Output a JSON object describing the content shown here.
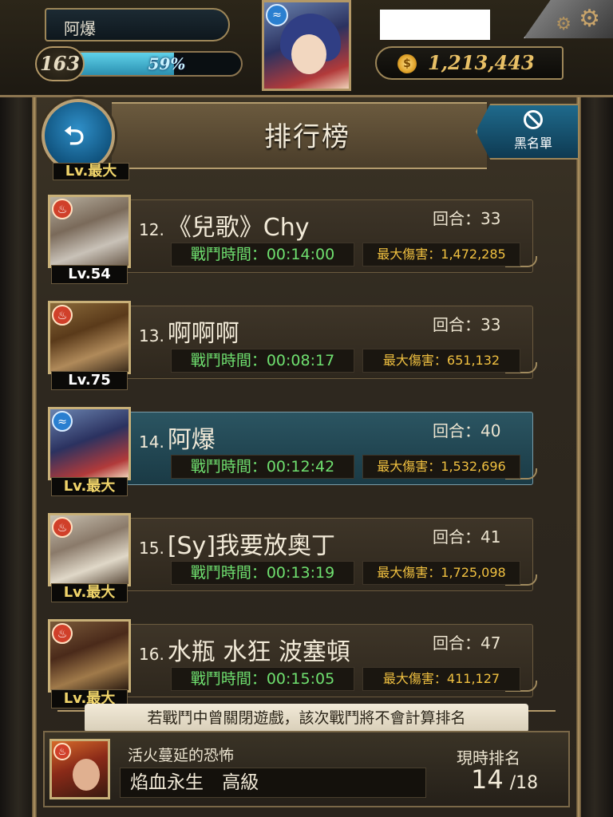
{
  "player": {
    "name": "阿爆",
    "level": "163",
    "exp_percent_text": "59%",
    "exp_fraction": 0.59,
    "coins": "1,213,443"
  },
  "header": {
    "title": "排行榜",
    "blacklist_label": "黑名單",
    "partial_level": "Lv.最大"
  },
  "rankings": [
    {
      "rank": "12.",
      "name": "《兒歌》Chy",
      "level": "Lv.54",
      "rounds": "回合：33",
      "time": "戰鬥時間：00:14:00",
      "damage": "最大傷害：1,472,285",
      "element": "fire"
    },
    {
      "rank": "13.",
      "name": "啊啊啊",
      "level": "Lv.75",
      "rounds": "回合：33",
      "time": "戰鬥時間：00:08:17",
      "damage": "最大傷害：651,132",
      "element": "fire"
    },
    {
      "rank": "14.",
      "name": "阿爆",
      "level": "Lv.最大",
      "rounds": "回合：40",
      "time": "戰鬥時間：00:12:42",
      "damage": "最大傷害：1,532,696",
      "element": "water",
      "highlight": true
    },
    {
      "rank": "15.",
      "name": "[Sy]我要放奧丁",
      "level": "Lv.最大",
      "rounds": "回合：41",
      "time": "戰鬥時間：00:13:19",
      "damage": "最大傷害：1,725,098",
      "element": "fire"
    },
    {
      "rank": "16.",
      "name": "水瓶 水狂 波塞頓",
      "level": "Lv.最大",
      "rounds": "回合：47",
      "time": "戰鬥時間：00:15:05",
      "damage": "最大傷害：411,127",
      "element": "fire"
    }
  ],
  "footer": {
    "notice": "若戰鬥中曾關閉遊戲，該次戰鬥將不會計算排名",
    "stage_name": "活火蔓延的恐怖",
    "difficulty": "焰血永生 高級",
    "current_rank_label": "現時排名",
    "current_rank": "14",
    "total": "/18"
  },
  "colors": {
    "accent_gold": "#b39867",
    "time_green": "#6fe06f",
    "damage_gold": "#f0c040",
    "highlight_row": "#2b5562"
  },
  "icons": {
    "back": "back-arrow-icon",
    "blacklist": "block-icon",
    "settings": "gear-icon",
    "coin": "coin-icon",
    "fire": "fire-element-icon",
    "water": "water-element-icon"
  }
}
